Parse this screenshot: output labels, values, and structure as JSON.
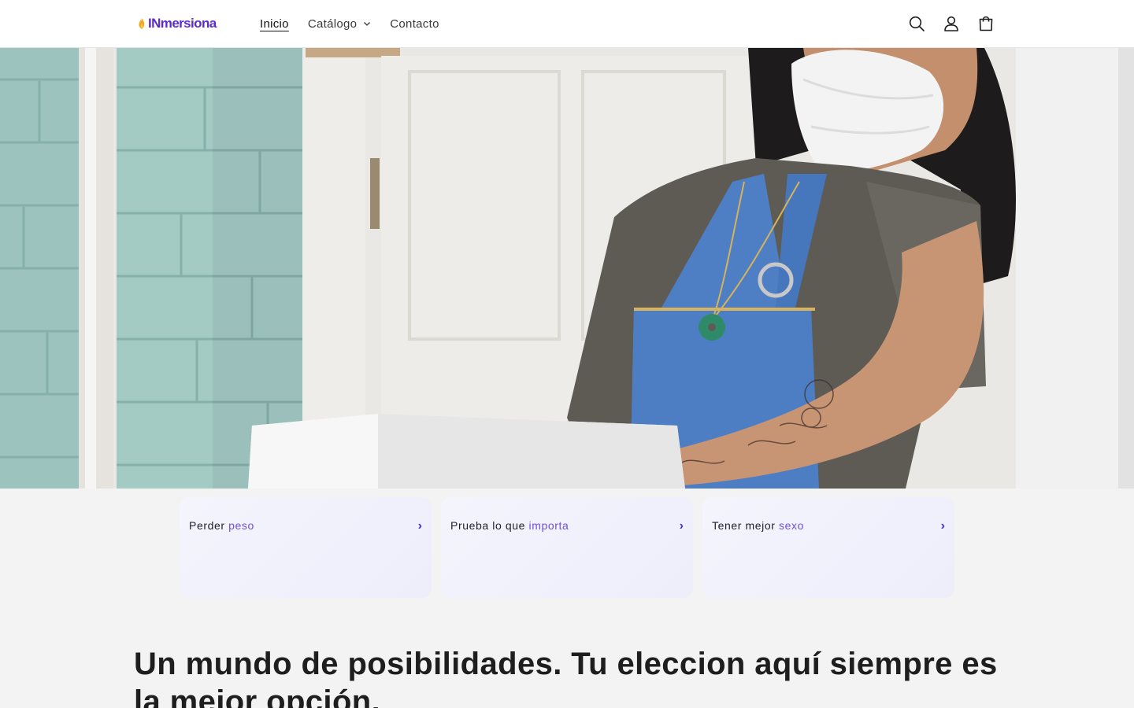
{
  "header": {
    "logo_text": "INmersiona",
    "nav": [
      {
        "label": "Inicio",
        "active": true
      },
      {
        "label": "Catálogo",
        "has_dropdown": true
      },
      {
        "label": "Contacto"
      }
    ],
    "icons": [
      "search-icon",
      "account-icon",
      "cart-icon"
    ]
  },
  "hero": {
    "image": "woman-in-apron-with-face-mask-carrying-box"
  },
  "cards": [
    {
      "title_prefix": "Perder",
      "title_accent": "peso",
      "arrow": "›"
    },
    {
      "title_prefix": "Prueba lo que",
      "title_accent": "importa",
      "arrow": "›"
    },
    {
      "title_prefix": "Tener mejor",
      "title_accent": "sexo",
      "arrow": "›"
    }
  ],
  "main": {
    "heading": "Un mundo de posibilidades. Tu eleccion aquí siempre es la mejor opción."
  },
  "colors": {
    "brand": "#5b2ad6",
    "accent": "#6f4fdd",
    "page_bg": "#f3f3f3",
    "card_bg": "#f2f2fc"
  }
}
